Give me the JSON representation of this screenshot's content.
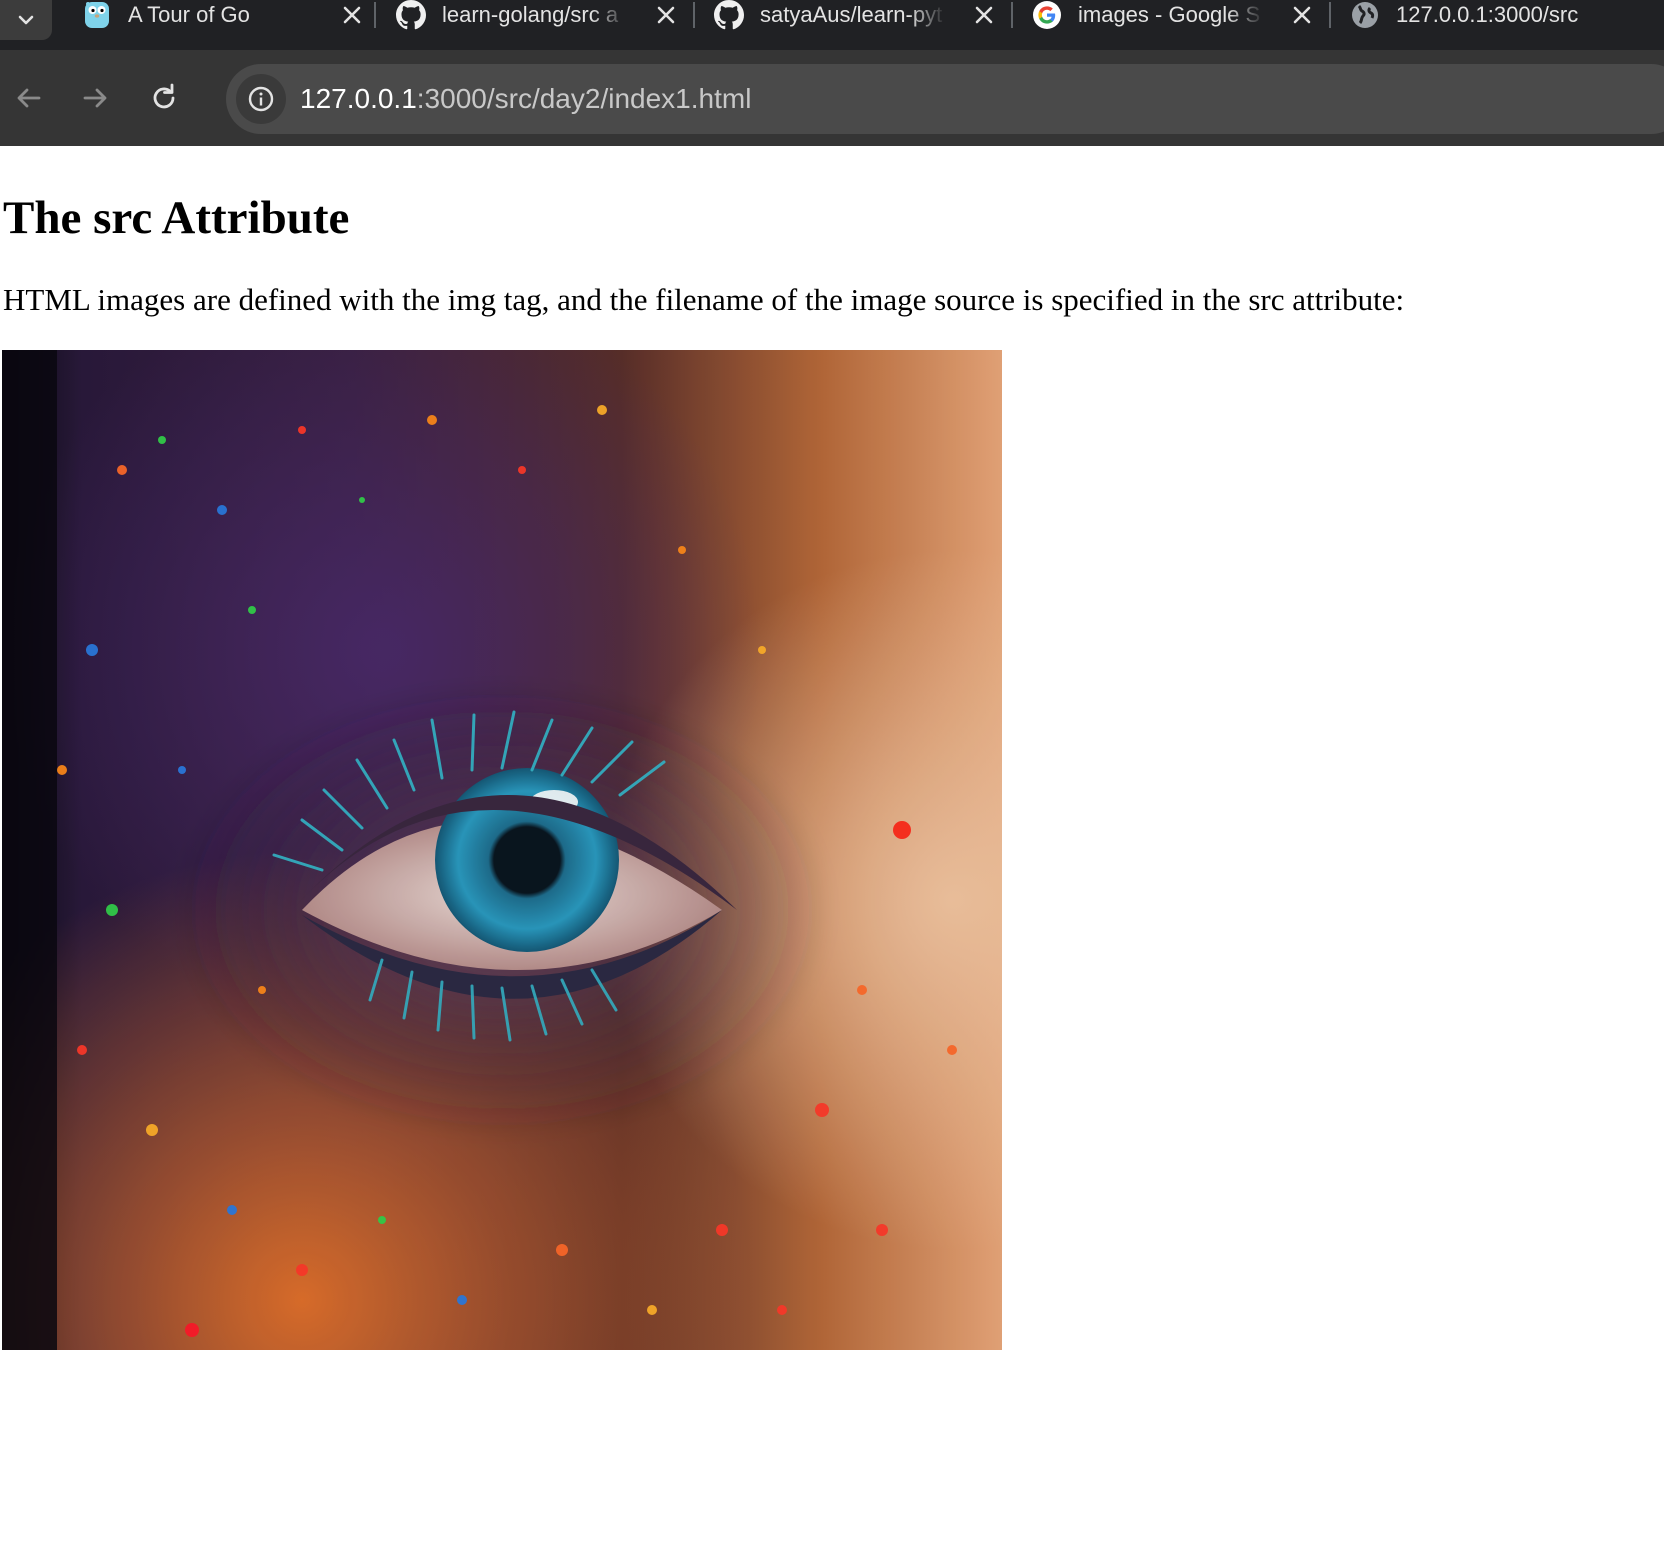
{
  "browser": {
    "tabs": [
      {
        "title": "A Tour of Go",
        "favicon": "gopher-icon"
      },
      {
        "title": "learn-golang/src a",
        "favicon": "github-icon"
      },
      {
        "title": "satyaAus/learn-pyt",
        "favicon": "github-icon"
      },
      {
        "title": "images - Google S",
        "favicon": "google-icon"
      },
      {
        "title": "127.0.0.1:3000/src",
        "favicon": "globe-icon"
      }
    ],
    "address_bar": {
      "host": "127.0.0.1",
      "path": ":3000/src/day2/index1.html"
    }
  },
  "page": {
    "heading": "The src Attribute",
    "paragraph": "HTML images are defined with the img tag, and the filename of the image source is specified in the src attribute:"
  },
  "colors": {
    "tabstrip_bg": "#202124",
    "toolbar_bg": "#353535",
    "omnibox_bg": "#4a4a4a",
    "iris": "#2a9ac0"
  }
}
